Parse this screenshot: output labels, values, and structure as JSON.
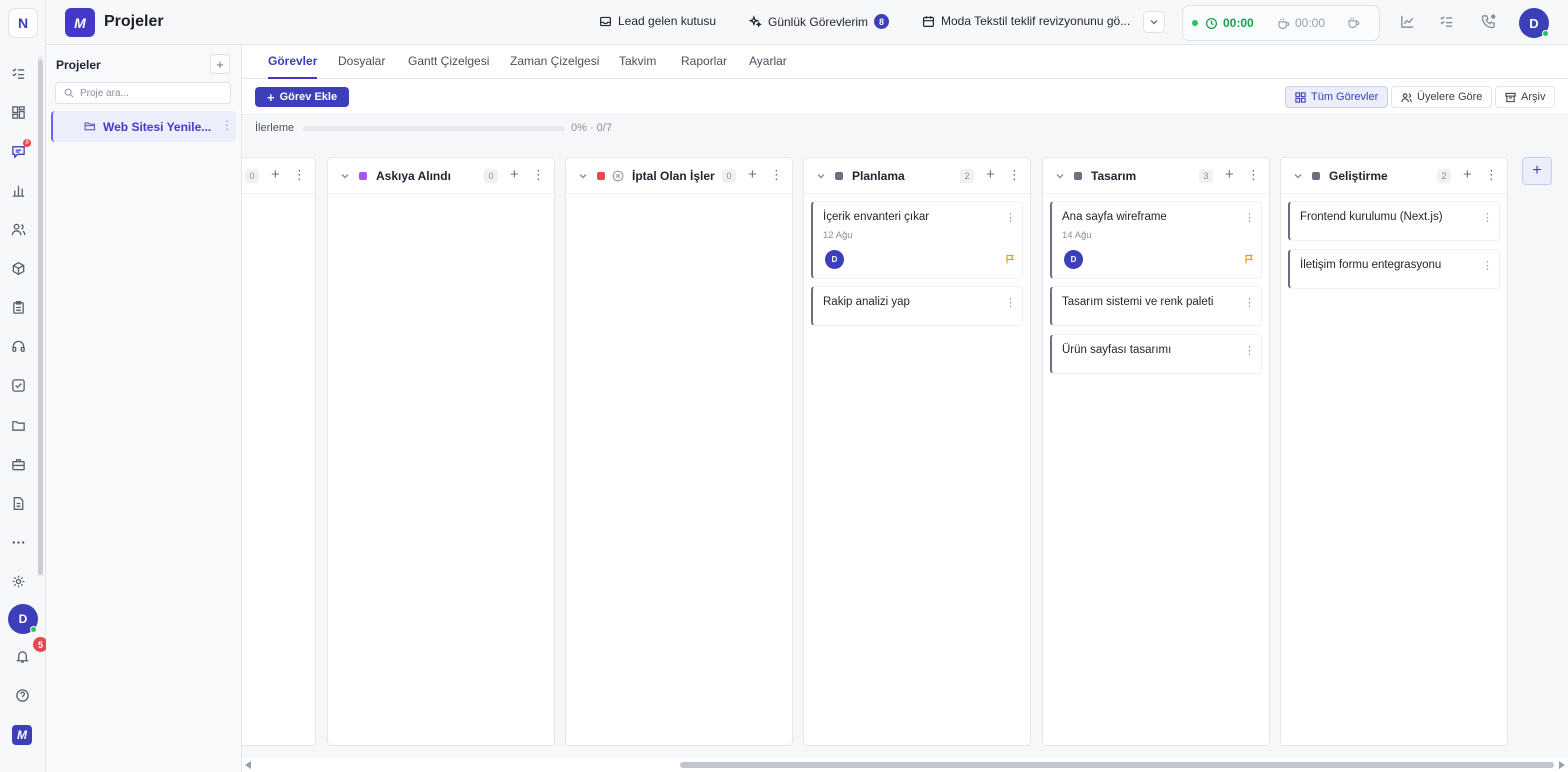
{
  "rail": {
    "workspace_letter": "N",
    "avatar_letter": "D",
    "notification_count": "5",
    "chat_badge": "8",
    "icons": [
      "tasks-icon",
      "dashboard-icon",
      "chat-icon",
      "chart-icon",
      "users-icon",
      "box-icon",
      "clipboard-icon",
      "headset-icon",
      "checkbox-icon",
      "folder-icon",
      "briefcase-icon",
      "document-icon",
      "more-icon",
      "settings-icon",
      "bell-icon",
      "help-icon",
      "brand-logo-icon"
    ]
  },
  "header": {
    "app_title": "Projeler",
    "lead_inbox": "Lead gelen kutusu",
    "daily_tasks": "Günlük Görevlerim",
    "daily_tasks_count": "8",
    "meeting": "Moda Tekstil teklif revizyonunu gö...",
    "timer_active": "00:00",
    "timer_break": "00:00",
    "avatar_letter": "D"
  },
  "sidebar": {
    "title": "Projeler",
    "search_placeholder": "Proje ara...",
    "projects": [
      {
        "label": "Web Sitesi Yenile..."
      }
    ]
  },
  "tabs": [
    {
      "label": "Görevler",
      "active": true
    },
    {
      "label": "Dosyalar"
    },
    {
      "label": "Gantt Çizelgesi"
    },
    {
      "label": "Zaman Çizelgesi"
    },
    {
      "label": "Takvim"
    },
    {
      "label": "Raporlar"
    },
    {
      "label": "Ayarlar"
    }
  ],
  "toolbar": {
    "add_task": "Görev Ekle",
    "all_tasks": "Tüm Görevler",
    "by_members": "Üyelere Göre",
    "archive": "Arşiv"
  },
  "progress": {
    "label": "İlerleme",
    "text": "0% · 0/7",
    "fraction": 0.0
  },
  "columns": [
    {
      "title": "",
      "count": "0",
      "color": "#9aa0ad",
      "cards": []
    },
    {
      "title": "Askıya Alındı",
      "count": "0",
      "color": "#a855f7",
      "cards": []
    },
    {
      "title": "İptal Olan İşler",
      "count": "0",
      "color": "#e5484d",
      "cards": []
    },
    {
      "title": "Planlama",
      "count": "2",
      "color": "#6b7080",
      "cards": [
        {
          "title": "İçerik envanteri çıkar",
          "date": "12 Ağu",
          "assignee": "D"
        },
        {
          "title": "Rakip analizi yap"
        }
      ]
    },
    {
      "title": "Tasarım",
      "count": "3",
      "color": "#6b7080",
      "cards": [
        {
          "title": "Ana sayfa wireframe",
          "date": "14 Ağu",
          "assignee": "D"
        },
        {
          "title": "Tasarım sistemi ve renk paleti"
        },
        {
          "title": "Ürün sayfası tasarımı"
        }
      ]
    },
    {
      "title": "Geliştirme",
      "count": "2",
      "color": "#6b7080",
      "cards": [
        {
          "title": "Frontend kurulumu (Next.js)"
        },
        {
          "title": "İletişim formu entegrasyonu"
        }
      ]
    }
  ]
}
